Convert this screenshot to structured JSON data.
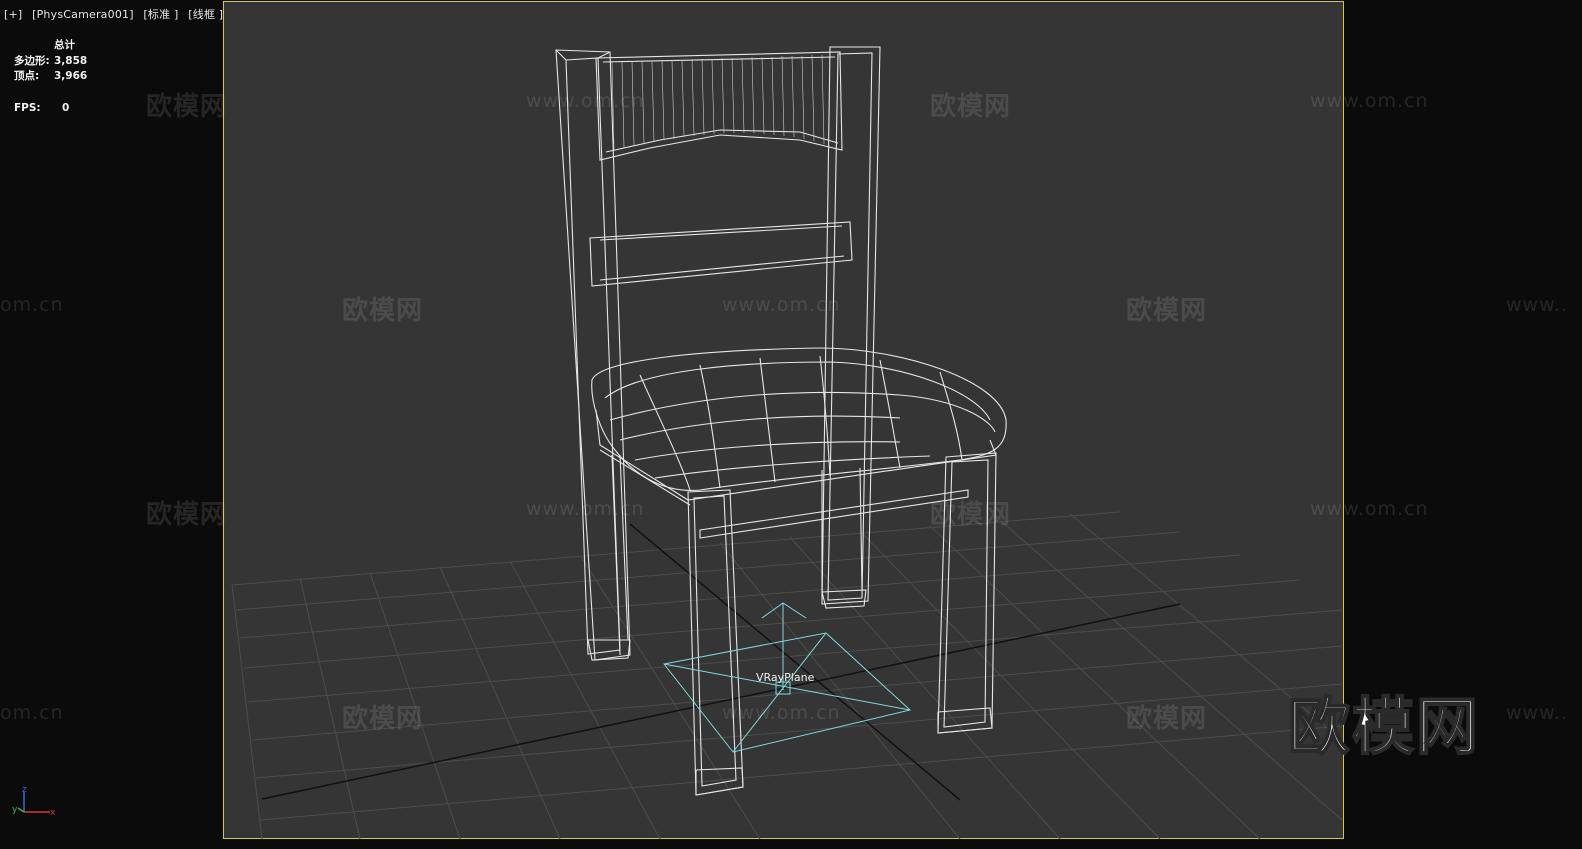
{
  "viewport": {
    "label_parts": [
      "[+]",
      "[PhysCamera001]",
      "[标准 ]",
      "[线框 ]"
    ]
  },
  "stats": {
    "header": "总计",
    "polygons_label": "多边形:",
    "polygons_value": "3,858",
    "vertices_label": "顶点:",
    "vertices_value": "3,966",
    "fps_label": "FPS:",
    "fps_value": "0"
  },
  "watermarks": {
    "brand": "欧模网",
    "url": "www.om.cn",
    "url_partial": "om.cn",
    "url_prefix": "www.."
  },
  "logo": "欧模网",
  "scene": {
    "object_label": "VRayPlane",
    "axis_x": "x",
    "axis_y": "y",
    "axis_z": "z"
  },
  "colors": {
    "background": "#0b0b0b",
    "viewport_bg": "#353535",
    "safe_frame": "#d8c53a",
    "wireframe": "#e6e6e6",
    "grid": "#4a4a4a",
    "gizmo": "#7fd8e0"
  }
}
